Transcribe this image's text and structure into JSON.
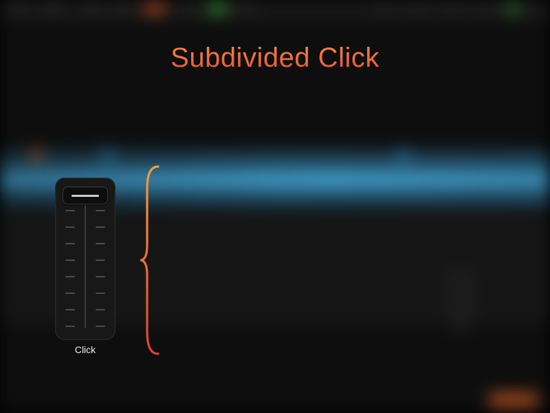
{
  "title": "Subdivided Click",
  "slider": {
    "label": "Click",
    "value_position": "top",
    "ticks_per_side": 8
  },
  "colors": {
    "accent_gradient_top": "#ff8a3d",
    "accent_gradient_bottom": "#e4532f",
    "waveform": "#3f9ecf"
  }
}
